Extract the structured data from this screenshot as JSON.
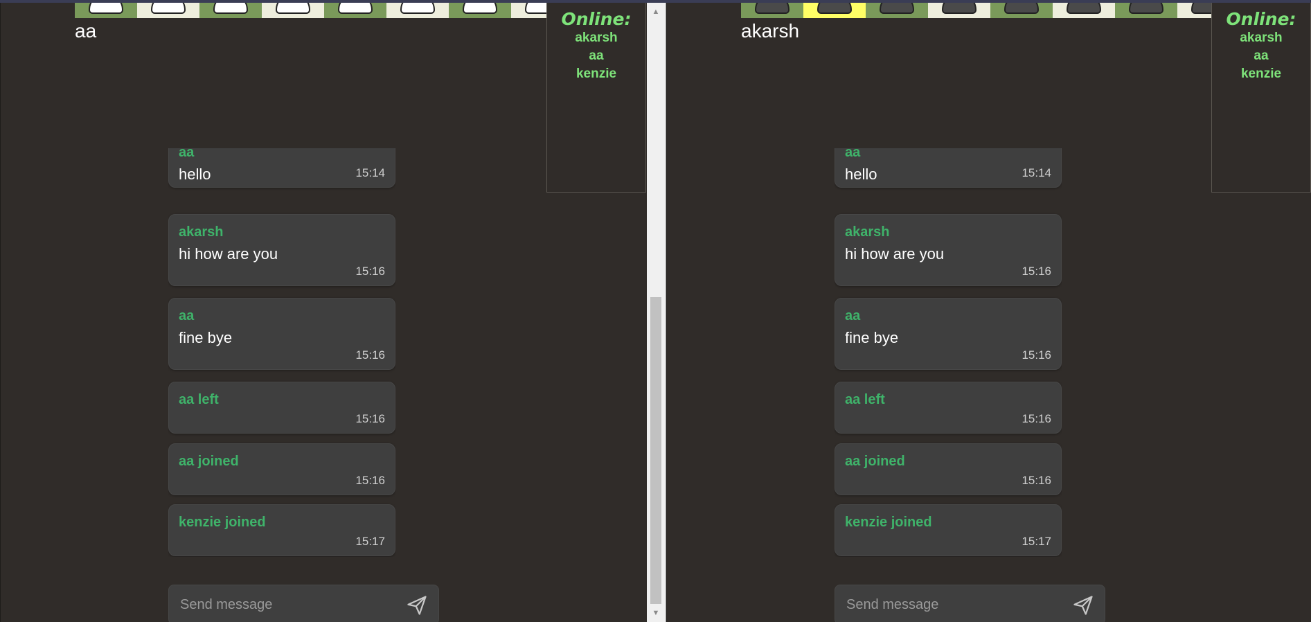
{
  "left": {
    "username": "aa",
    "online_title": "Online:",
    "online_users": [
      "akarsh",
      "aa",
      "kenzie"
    ],
    "highlight_key_index": null,
    "pad_style": "white"
  },
  "right": {
    "username": "akarsh",
    "online_title": "Online:",
    "online_users": [
      "akarsh",
      "aa",
      "kenzie"
    ],
    "highlight_key_index": 1,
    "pad_style": "dark"
  },
  "key_colors": [
    "#7a9a5a",
    "#eeeedd",
    "#7a9a5a",
    "#eeeedd",
    "#7a9a5a",
    "#eeeedd",
    "#7a9a5a",
    "#eeeedd"
  ],
  "highlight_color": "#ffff66",
  "messages": [
    {
      "name": "aa",
      "text": "hello",
      "time": "15:14"
    },
    {
      "name": "akarsh",
      "text": "hi how are you",
      "time": "15:16"
    },
    {
      "name": "aa",
      "text": "fine bye",
      "time": "15:16"
    },
    {
      "name": "aa left",
      "text": "",
      "time": "15:16"
    },
    {
      "name": "aa joined",
      "text": "",
      "time": "15:16"
    },
    {
      "name": "kenzie joined",
      "text": "",
      "time": "15:17"
    }
  ],
  "composer": {
    "placeholder": "Send message"
  },
  "scrollbar": {
    "up": "▲",
    "down": "▼"
  }
}
